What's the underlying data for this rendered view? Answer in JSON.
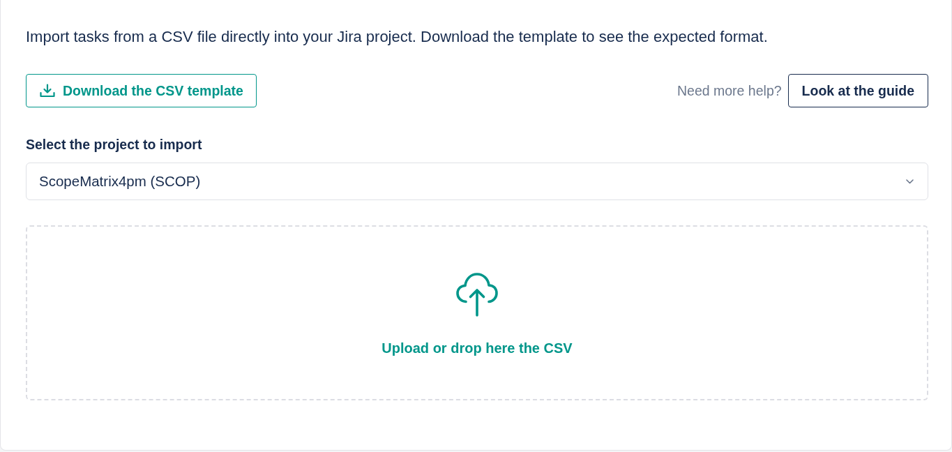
{
  "intro": {
    "text": "Import tasks from a CSV file directly into your Jira project. Download the template to see the expected format."
  },
  "actions": {
    "download_button": {
      "label": "Download the CSV template"
    },
    "help_text": "Need more help?",
    "guide_button": {
      "label": "Look at the guide"
    }
  },
  "project_select": {
    "label": "Select the project to import",
    "value": "ScopeMatrix4pm (SCOP)"
  },
  "upload": {
    "label": "Upload or drop here the CSV"
  }
}
